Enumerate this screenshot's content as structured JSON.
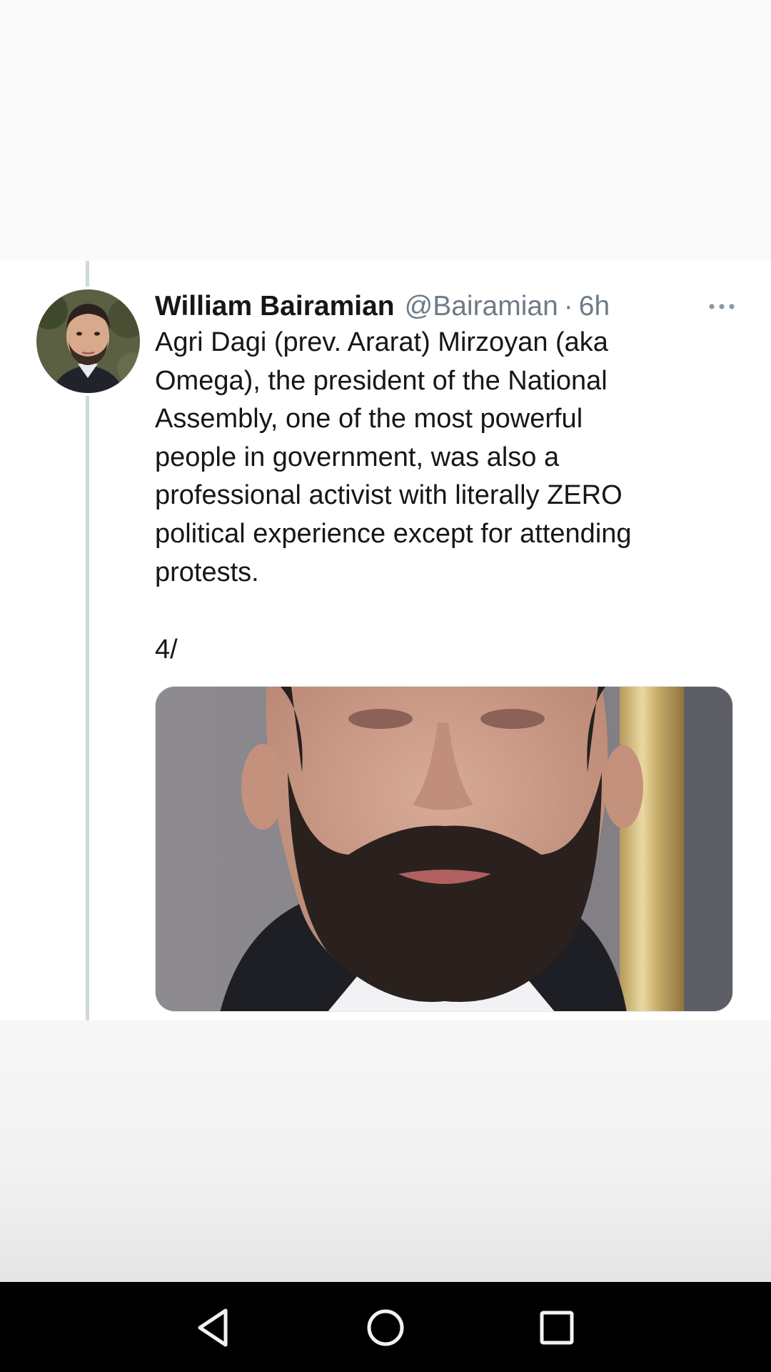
{
  "tweet": {
    "display_name": "William Bairamian",
    "handle": "@Bairamian",
    "separator": "·",
    "time": "6h",
    "text": "Agri Dagi (prev. Ararat) Mirzoyan (aka\nOmega), the president of the National\nAssembly, one of the most powerful\npeople in government, was also a\nprofessional activist with literally ZERO\npolitical experience except for attending\nprotests.",
    "thread_counter": "4/",
    "avatar_alt": "Profile photo of William Bairamian",
    "image_alt": "Close-up photo of a bearded man in a suit"
  },
  "icons": {
    "more": "more-options-icon",
    "back": "back-triangle-icon",
    "home": "home-circle-icon",
    "recent": "recent-apps-square-icon"
  },
  "colors": {
    "text_primary": "#14171a",
    "text_secondary": "#6e7b87",
    "thread_line": "#cfd9de",
    "nav_bar": "#000000"
  }
}
